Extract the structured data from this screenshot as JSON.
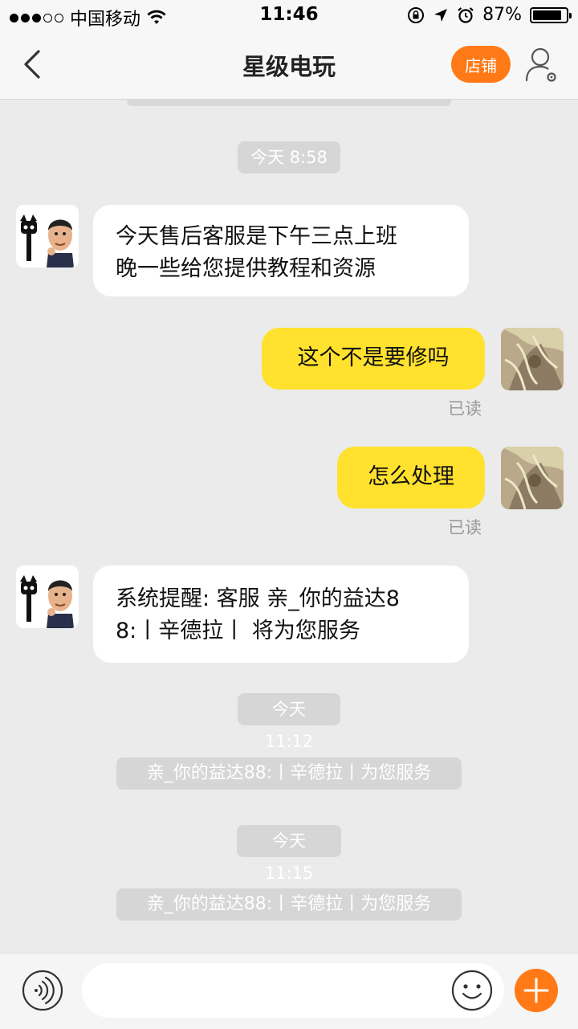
{
  "status_bar": {
    "carrier": "中国移动",
    "time": "11:46",
    "battery_percent": "87%",
    "battery_level": 0.87,
    "signal_bars_filled": 3,
    "signal_bars_total": 5
  },
  "nav": {
    "title": "星级电玩",
    "shop_label": "店铺",
    "accent_color": "#ff7a17"
  },
  "messages": {
    "time_1": "今天 8:58",
    "msg_1_line_1": "今天售后客服是下午三点上班",
    "msg_1_line_2": "晚一些给您提供教程和资源",
    "msg_2": "这个不是要修吗",
    "msg_2_status": "已读",
    "msg_3": "怎么处理",
    "msg_3_status": "已读",
    "msg_4_line_1": "系统提醒: 客服 亲_你的益达8",
    "msg_4_line_2": "8:丨辛德拉丨 将为您服务",
    "time_2": "今天 11:12",
    "sys_1": "亲_你的益达88:丨辛德拉丨为您服务",
    "time_3": "今天 11:15",
    "sys_2": "亲_你的益达88:丨辛德拉丨为您服务"
  },
  "input": {
    "placeholder": ""
  },
  "colors": {
    "outgoing_bubble": "#ffe12e",
    "incoming_bubble": "#ffffff",
    "background": "#ebebeb"
  }
}
